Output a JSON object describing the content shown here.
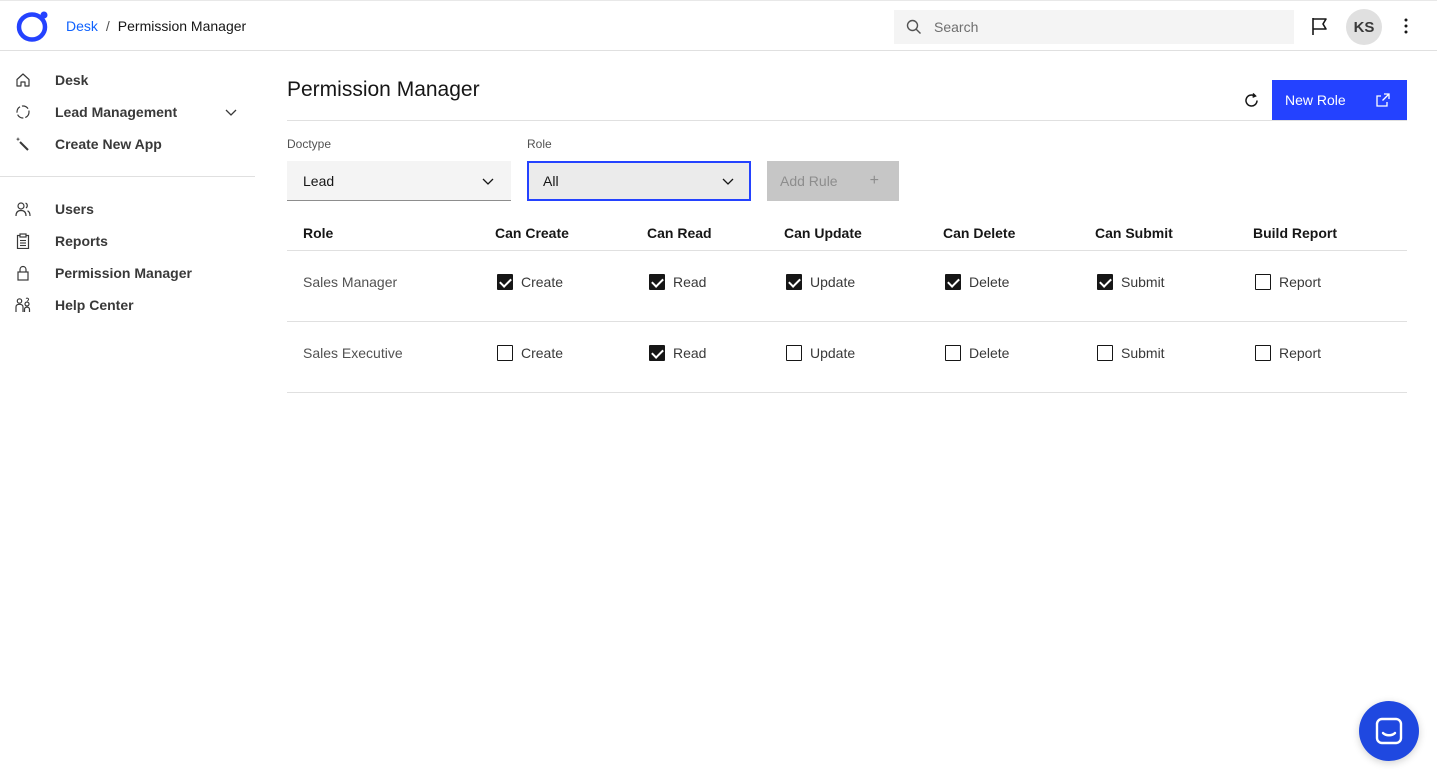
{
  "header": {
    "breadcrumb": {
      "link": "Desk",
      "separator": "/",
      "current": "Permission Manager"
    },
    "search": {
      "placeholder": "Search",
      "value": ""
    },
    "avatar_initials": "KS",
    "icons": [
      "app-logo-icon",
      "search-icon",
      "flag-icon",
      "overflow-menu-icon"
    ]
  },
  "sidebar": {
    "items": [
      {
        "label": "Desk",
        "icon": "home-icon"
      },
      {
        "label": "Lead Management",
        "icon": "dashed-circle-icon",
        "expandable": true
      },
      {
        "label": "Create New App",
        "icon": "magic-wand-icon"
      },
      {
        "label": "Users",
        "icon": "users-icon"
      },
      {
        "label": "Reports",
        "icon": "clipboard-icon"
      },
      {
        "label": "Permission Manager",
        "icon": "lock-icon"
      },
      {
        "label": "Help Center",
        "icon": "help-people-icon"
      }
    ]
  },
  "main": {
    "title": "Permission Manager",
    "new_role_label": "New Role",
    "filters": {
      "doctype": {
        "label": "Doctype",
        "value": "Lead"
      },
      "role": {
        "label": "Role",
        "value": "All"
      },
      "add_rule_label": "Add Rule",
      "add_rule_icon": "+"
    },
    "table": {
      "columns": [
        "Role",
        "Can Create",
        "Can Read",
        "Can Update",
        "Can Delete",
        "Can Submit",
        "Build Report"
      ],
      "rows": [
        {
          "role": "Sales Manager",
          "permissions": [
            {
              "label": "Create",
              "checked": true
            },
            {
              "label": "Read",
              "checked": true
            },
            {
              "label": "Update",
              "checked": true
            },
            {
              "label": "Delete",
              "checked": true
            },
            {
              "label": "Submit",
              "checked": true
            },
            {
              "label": "Report",
              "checked": false
            }
          ]
        },
        {
          "role": "Sales Executive",
          "permissions": [
            {
              "label": "Create",
              "checked": false
            },
            {
              "label": "Read",
              "checked": true
            },
            {
              "label": "Update",
              "checked": false
            },
            {
              "label": "Delete",
              "checked": false
            },
            {
              "label": "Submit",
              "checked": false
            },
            {
              "label": "Report",
              "checked": false
            }
          ]
        }
      ]
    }
  },
  "colors": {
    "accent": "#2442ff",
    "link": "#0f62fe",
    "chat_launcher": "#1f48e0",
    "disabled_button": "#c6c6c6"
  }
}
